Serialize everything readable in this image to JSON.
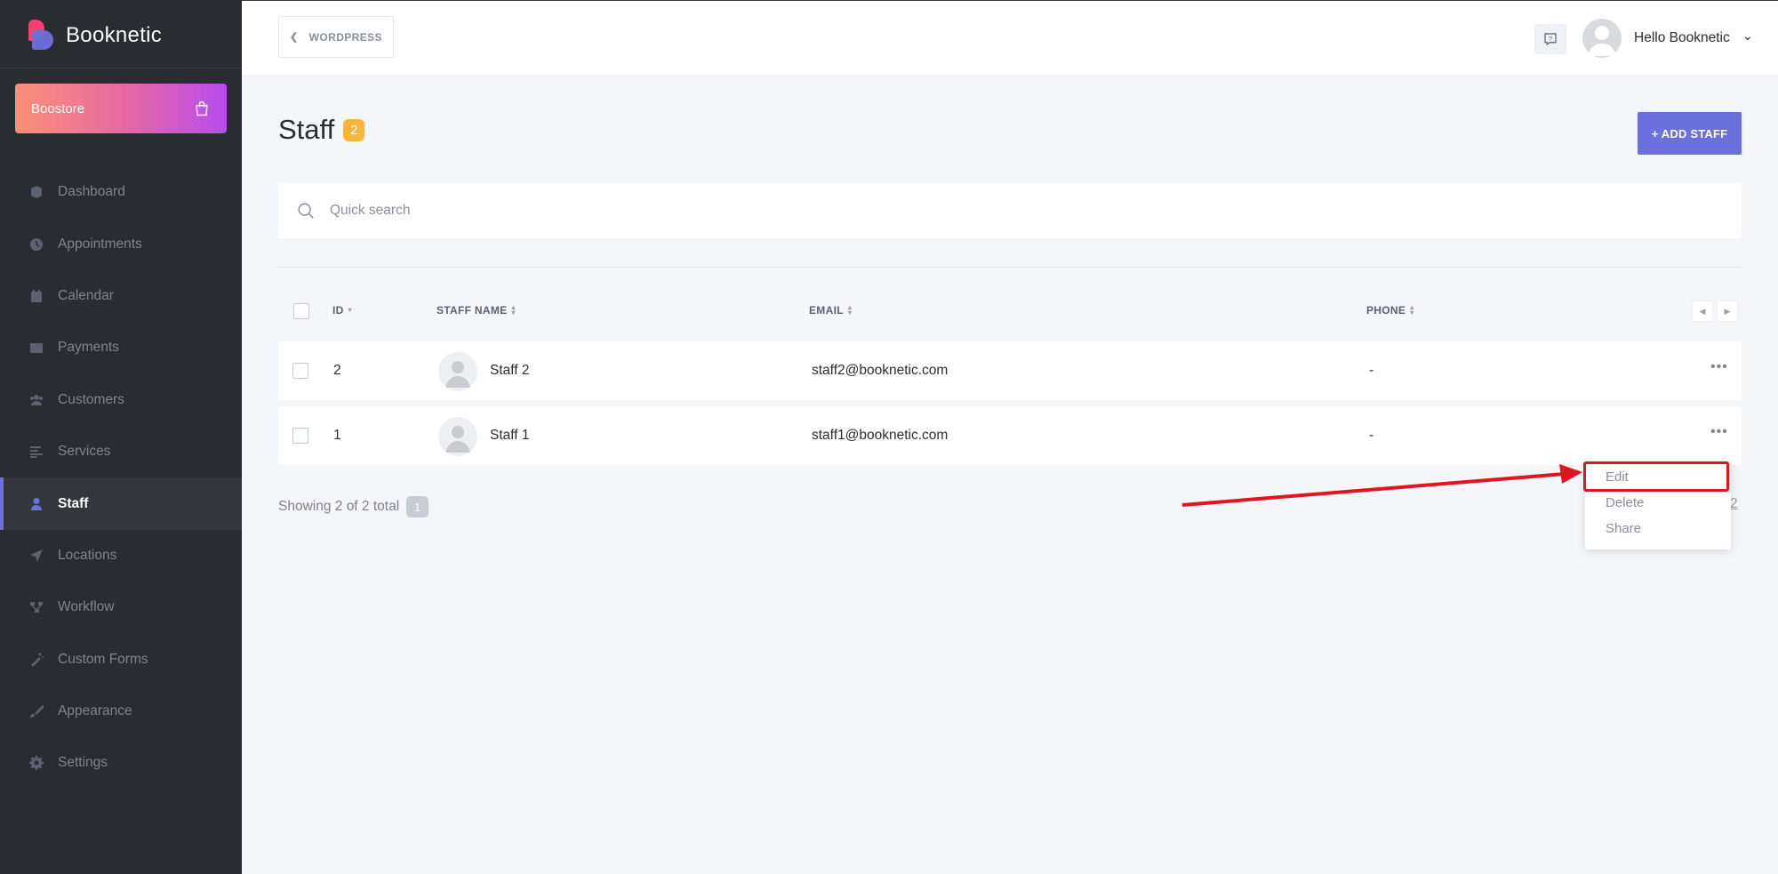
{
  "app": {
    "name": "Booknetic"
  },
  "sidebar": {
    "boostore_label": "Boostore",
    "items": [
      {
        "label": "Dashboard",
        "icon": "cube-icon"
      },
      {
        "label": "Appointments",
        "icon": "clock-icon"
      },
      {
        "label": "Calendar",
        "icon": "calendar-icon"
      },
      {
        "label": "Payments",
        "icon": "wallet-icon"
      },
      {
        "label": "Customers",
        "icon": "users-icon"
      },
      {
        "label": "Services",
        "icon": "list-icon"
      },
      {
        "label": "Staff",
        "icon": "user-icon",
        "active": true
      },
      {
        "label": "Locations",
        "icon": "location-arrow-icon"
      },
      {
        "label": "Workflow",
        "icon": "workflow-icon"
      },
      {
        "label": "Custom Forms",
        "icon": "magic-wand-icon"
      },
      {
        "label": "Appearance",
        "icon": "brush-icon"
      },
      {
        "label": "Settings",
        "icon": "gear-icon"
      }
    ]
  },
  "topbar": {
    "back_label": "WORDPRESS",
    "user_greeting": "Hello Booknetic"
  },
  "page": {
    "title": "Staff",
    "count": "2",
    "add_button": "+ ADD STAFF",
    "search_placeholder": "Quick search"
  },
  "table": {
    "columns": {
      "id": "ID",
      "name": "STAFF NAME",
      "email": "EMAIL",
      "phone": "PHONE"
    },
    "rows": [
      {
        "id": "2",
        "name": "Staff 2",
        "email": "staff2@booknetic.com",
        "phone": "-"
      },
      {
        "id": "1",
        "name": "Staff 1",
        "email": "staff1@booknetic.com",
        "phone": "-"
      }
    ],
    "footer": "Showing 2 of 2 total",
    "current_page": "1",
    "right_page_fragment": "2"
  },
  "row_menu": {
    "edit": "Edit",
    "delete": "Delete",
    "share": "Share"
  },
  "colors": {
    "accent": "#6c70dc",
    "badge": "#fcb53b",
    "sidebar": "#292d32",
    "annotation": "#e0161f"
  }
}
